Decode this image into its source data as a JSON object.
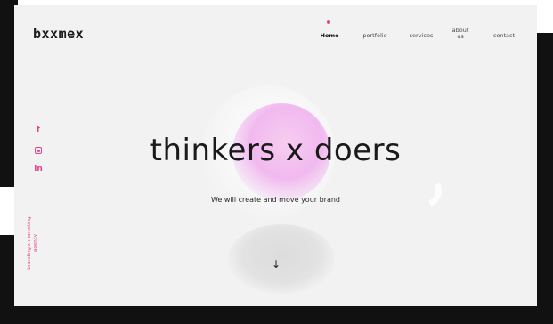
{
  "brand": {
    "logo": "bxxmex",
    "accent": "#e8418b"
  },
  "nav": {
    "items": [
      {
        "label": "Home",
        "active": true
      },
      {
        "label": "portfolio",
        "active": false
      },
      {
        "label": "services",
        "active": false
      },
      {
        "label": "about\nus",
        "active": false
      },
      {
        "label": "contact",
        "active": false
      }
    ]
  },
  "social": {
    "facebook": "f",
    "instagram_icon": "instagram-icon",
    "linkedin": "in"
  },
  "side_tag": "branding x marketing agency",
  "hero": {
    "headline": "thinkers x doers",
    "subline": "We will create and move your brand",
    "scroll_icon": "arrow-down-icon",
    "scroll_glyph": "↓"
  }
}
